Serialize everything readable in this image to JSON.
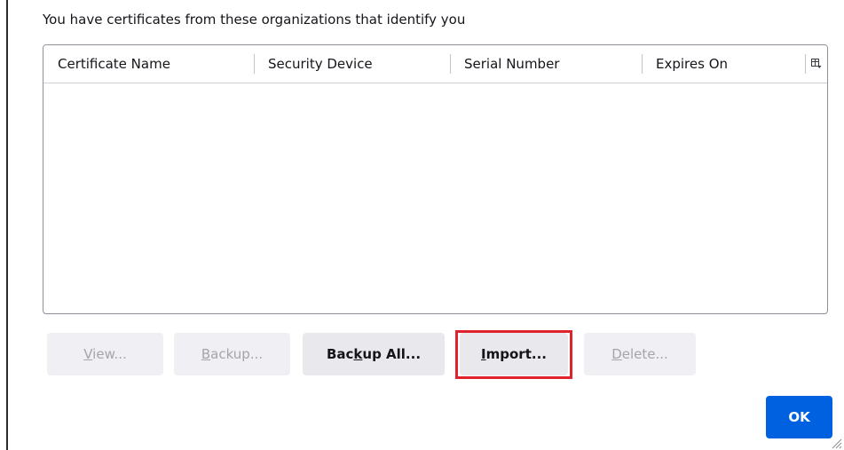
{
  "description": "You have certificates from these organizations that identify you",
  "table": {
    "columns": [
      "Certificate Name",
      "Security Device",
      "Serial Number",
      "Expires On"
    ],
    "column_picker_icon": "column-picker-icon",
    "rows": []
  },
  "buttons": {
    "view": {
      "pre": "",
      "key": "V",
      "post": "iew...",
      "enabled": false
    },
    "backup": {
      "pre": "",
      "key": "B",
      "post": "ackup...",
      "enabled": false
    },
    "backup_all": {
      "pre": "Bac",
      "key": "k",
      "post": "up All...",
      "enabled": true
    },
    "import": {
      "pre": "",
      "key": "I",
      "post": "mport...",
      "enabled": true
    },
    "delete": {
      "pre": "",
      "key": "D",
      "post": "elete...",
      "enabled": false
    },
    "ok": {
      "label": "OK",
      "enabled": true
    }
  },
  "colors": {
    "accent": "#0061e0",
    "highlight": "#e0212e"
  }
}
